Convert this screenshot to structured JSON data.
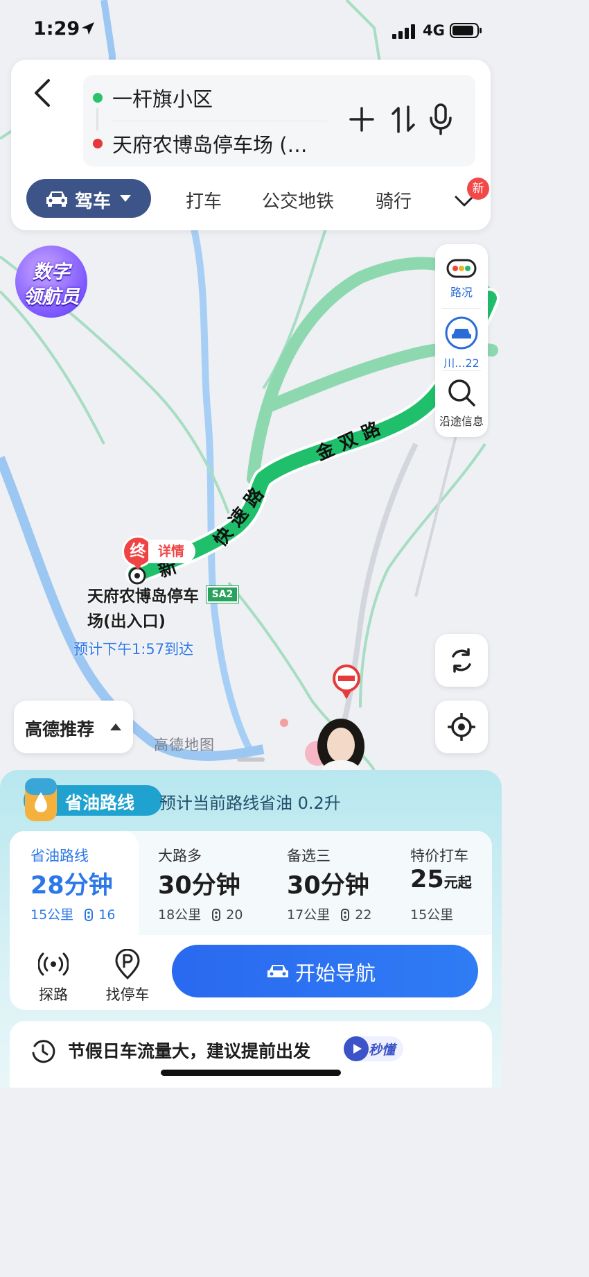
{
  "status_bar": {
    "time": "1:29",
    "network": "4G"
  },
  "search": {
    "from": "一杆旗小区",
    "to": "天府农博岛停车场 (…"
  },
  "modes": {
    "drive": "驾车",
    "taxi": "打车",
    "transit": "公交地铁",
    "bike": "骑行",
    "new_badge": "新"
  },
  "digital_navigator": {
    "line1": "数字",
    "line2": "领航员"
  },
  "side_tools": {
    "traffic": "路况",
    "plate": "川...22",
    "along": "沿途信息"
  },
  "map": {
    "road_1": "金双路",
    "road_2": "快速路",
    "road_3": "新",
    "end_marker": "终",
    "end_detail": "详情",
    "destination_name": "天府农博岛停车场(出入口)",
    "eta": "预计下午1:57到达",
    "highway_shield": "SA2",
    "watermark": "高德地图"
  },
  "recommend": {
    "label": "高德推荐"
  },
  "fuel": {
    "badge": "省油路线",
    "desc": "预计当前路线省油 0.2升"
  },
  "routes": [
    {
      "name": "省油路线",
      "time": "28分钟",
      "distance": "15公里",
      "lights": "16",
      "selected": true
    },
    {
      "name": "大路多",
      "time": "30分钟",
      "distance": "18公里",
      "lights": "20",
      "selected": false
    },
    {
      "name": "备选三",
      "time": "30分钟",
      "distance": "17公里",
      "lights": "22",
      "selected": false
    }
  ],
  "taxi_offer": {
    "name": "特价打车",
    "price": "25",
    "unit": "元起",
    "distance": "15公里"
  },
  "actions": {
    "explore": "探路",
    "parking": "找停车",
    "start": "开始导航"
  },
  "tip": {
    "text": "节假日车流量大，建议提前出发",
    "button": "秒懂"
  },
  "colors": {
    "route_green": "#1fbf6b",
    "primary_blue": "#2d78e8",
    "drive_tab": "#3d5488"
  }
}
